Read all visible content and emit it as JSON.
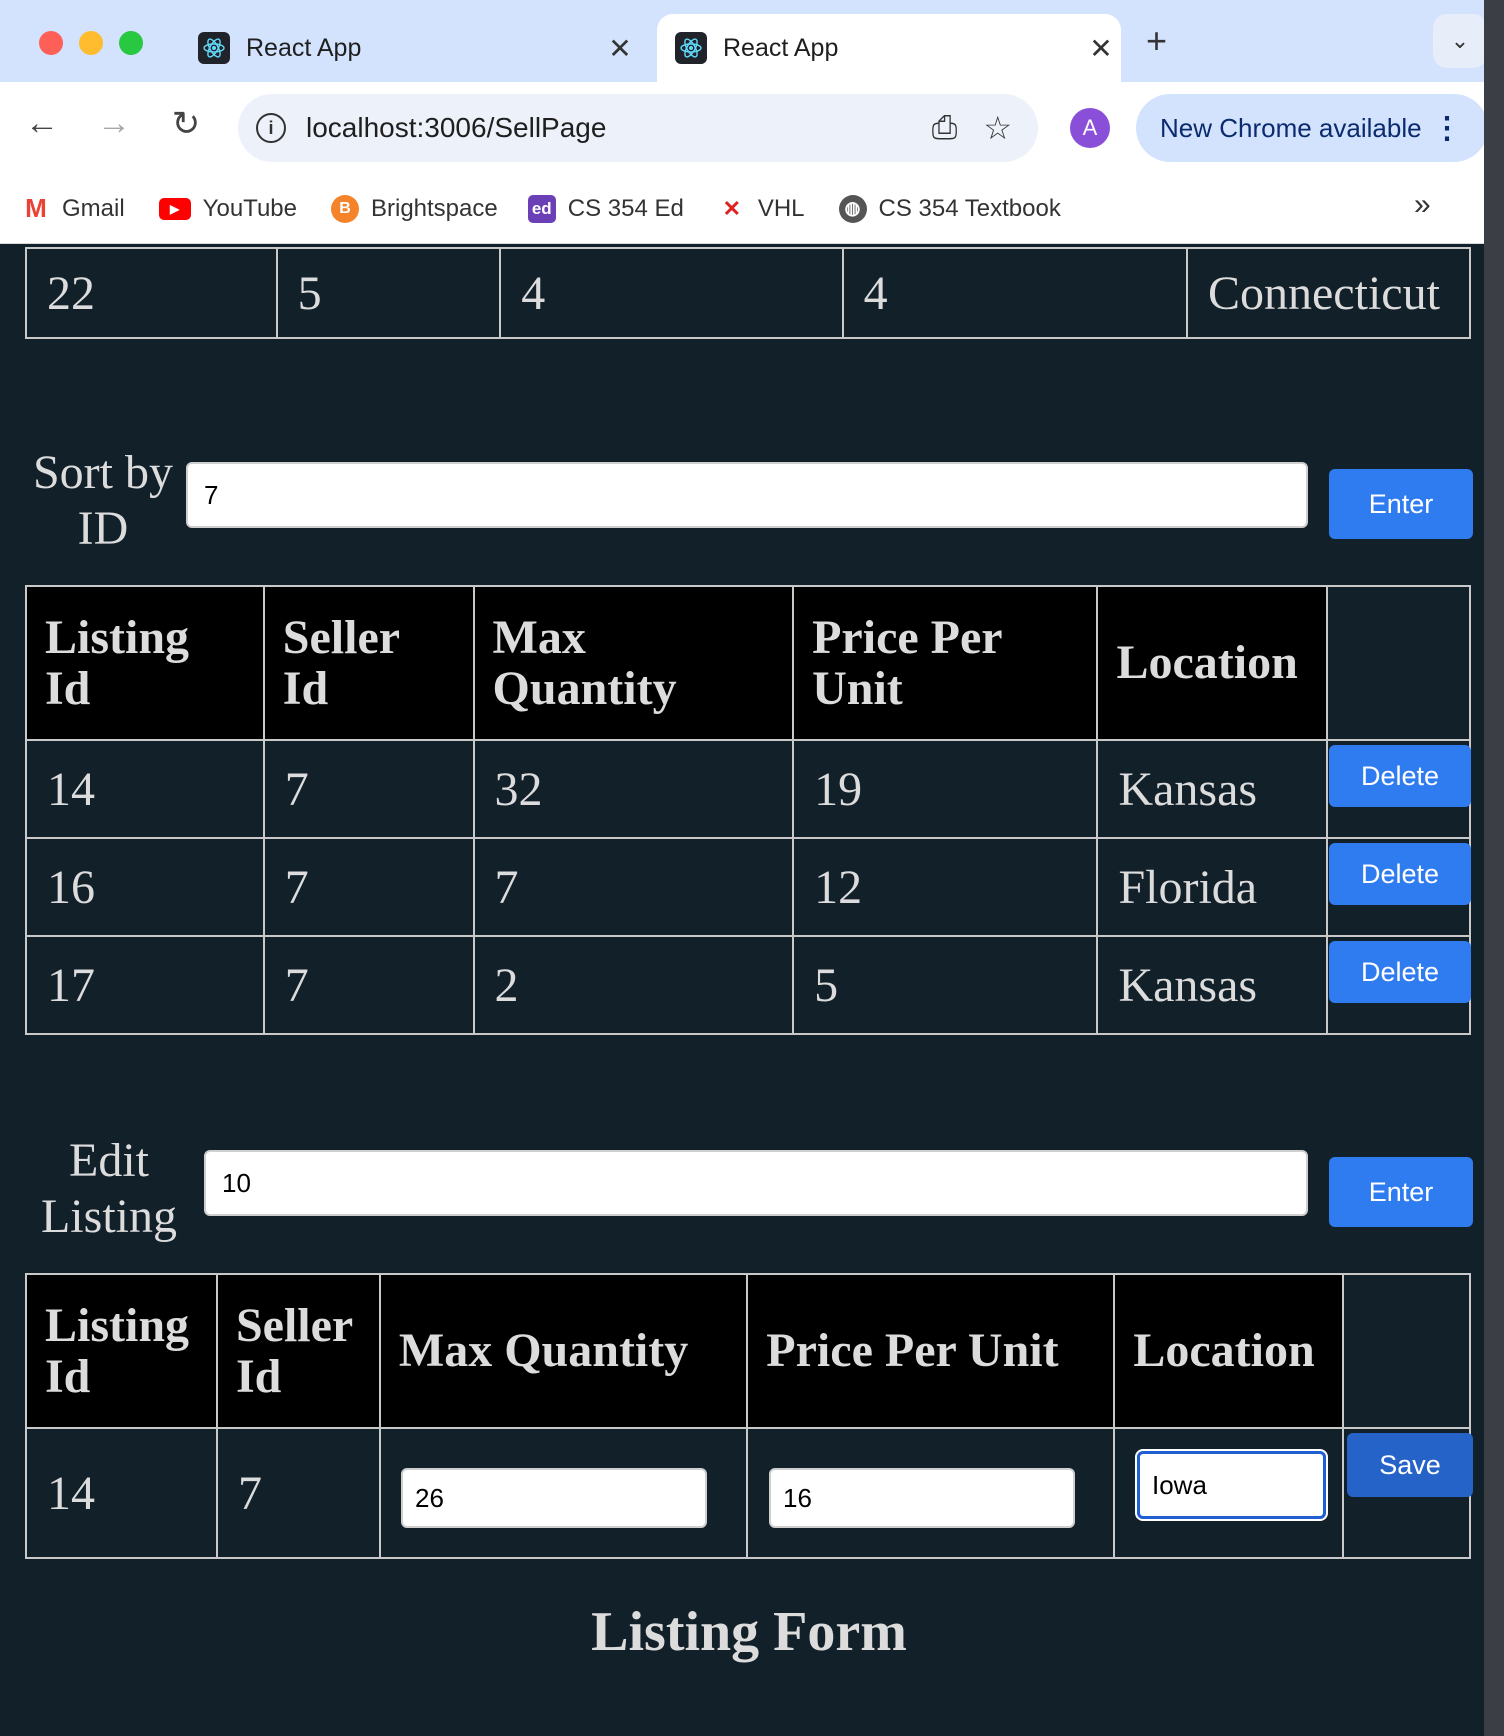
{
  "browser": {
    "tabs": [
      {
        "title": "React App",
        "active": false
      },
      {
        "title": "React App",
        "active": true
      }
    ],
    "url": "localhost:3006/SellPage",
    "avatar_letter": "A",
    "update_label": "New Chrome available",
    "bookmarks": [
      {
        "label": "Gmail",
        "icon": "gmail-icon"
      },
      {
        "label": "YouTube",
        "icon": "youtube-icon"
      },
      {
        "label": "Brightspace",
        "icon": "brightspace-icon"
      },
      {
        "label": "CS 354 Ed",
        "icon": "ed-icon"
      },
      {
        "label": "VHL",
        "icon": "vhl-icon"
      },
      {
        "label": "CS 354 Textbook",
        "icon": "globe-icon"
      }
    ]
  },
  "top_row": {
    "cells": [
      "22",
      "5",
      "4",
      "4",
      "Connecticut"
    ]
  },
  "sort": {
    "label_line1": "Sort by",
    "label_line2": "ID",
    "value": "7",
    "button": "Enter"
  },
  "listing_table": {
    "headers": [
      [
        "Listing",
        "Id"
      ],
      [
        "Seller",
        "Id"
      ],
      [
        "Max",
        "Quantity"
      ],
      [
        "Price Per",
        "Unit"
      ],
      [
        "Location",
        ""
      ]
    ],
    "rows": [
      {
        "listing_id": "14",
        "seller_id": "7",
        "max_quantity": "32",
        "price": "19",
        "location": "Kansas"
      },
      {
        "listing_id": "16",
        "seller_id": "7",
        "max_quantity": "7",
        "price": "12",
        "location": "Florida"
      },
      {
        "listing_id": "17",
        "seller_id": "7",
        "max_quantity": "2",
        "price": "5",
        "location": "Kansas"
      }
    ],
    "delete_label": "Delete"
  },
  "edit": {
    "label_line1": "Edit",
    "label_line2": "Listing",
    "value": "10",
    "button": "Enter"
  },
  "edit_table": {
    "headers": [
      [
        "Listing",
        "Id"
      ],
      [
        "Seller",
        "Id"
      ],
      [
        "Max Quantity",
        ""
      ],
      [
        "Price Per Unit",
        ""
      ],
      [
        "Location",
        ""
      ]
    ],
    "row": {
      "listing_id": "14",
      "seller_id": "7",
      "max_quantity": "26",
      "price": "16",
      "location": "Iowa"
    },
    "save_label": "Save"
  },
  "form_title": "Listing Form",
  "colors": {
    "page_bg": "#12202a",
    "header_bg": "#000000",
    "button_blue": "#2f7bf0",
    "save_blue": "#2563c9"
  }
}
